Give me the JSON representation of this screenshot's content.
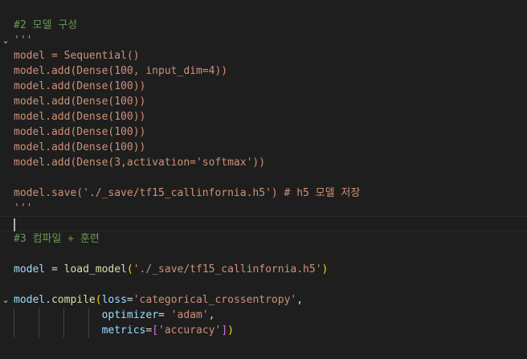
{
  "colors": {
    "background": "#1e1e1e",
    "comment": "#6a9955",
    "string": "#ce9178",
    "text": "#d4d4d4",
    "function": "#dcdcaa",
    "variable": "#9cdcfe",
    "number": "#b5cea8",
    "class": "#4ec9b0"
  },
  "code": {
    "l1": "#2 모델 구성",
    "l2": "'''",
    "l3": "model = Sequential()",
    "l4": "model.add(Dense(100, input_dim=4))",
    "l5": "model.add(Dense(100))",
    "l6": "model.add(Dense(100))",
    "l7": "model.add(Dense(100))",
    "l8": "model.add(Dense(100))",
    "l9": "model.add(Dense(100))",
    "l10": "model.add(Dense(3,activation='softmax'))",
    "l11": "",
    "l12": "model.save('./_save/tf15_callinfornia.h5') # h5 모델 저장",
    "l13": "'''",
    "l14": "",
    "l15": "#3 컴파일 + 훈련",
    "l16": "",
    "l17": {
      "var": "model",
      "op": " = ",
      "fn": "load_model",
      "open": "(",
      "str": "'./_save/tf15_callinfornia.h5'",
      "close": ")"
    },
    "l18": "",
    "l19": {
      "var": "model",
      "dot": ".",
      "fn": "compile",
      "open": "(",
      "param": "loss",
      "eq": "=",
      "str": "'categorical_crossentropy'",
      "comma": ","
    },
    "l20": {
      "indent": "              ",
      "param": "optimizer",
      "eq": "= ",
      "str": "'adam'",
      "comma": ","
    },
    "l21": {
      "indent": "              ",
      "param": "metrics",
      "eq": "=",
      "open": "[",
      "str": "'accuracy'",
      "close": "]",
      "close2": ")"
    }
  },
  "gutter": {
    "fold_icon": "chevron-down-icon",
    "fold_glyph": "⌄"
  }
}
